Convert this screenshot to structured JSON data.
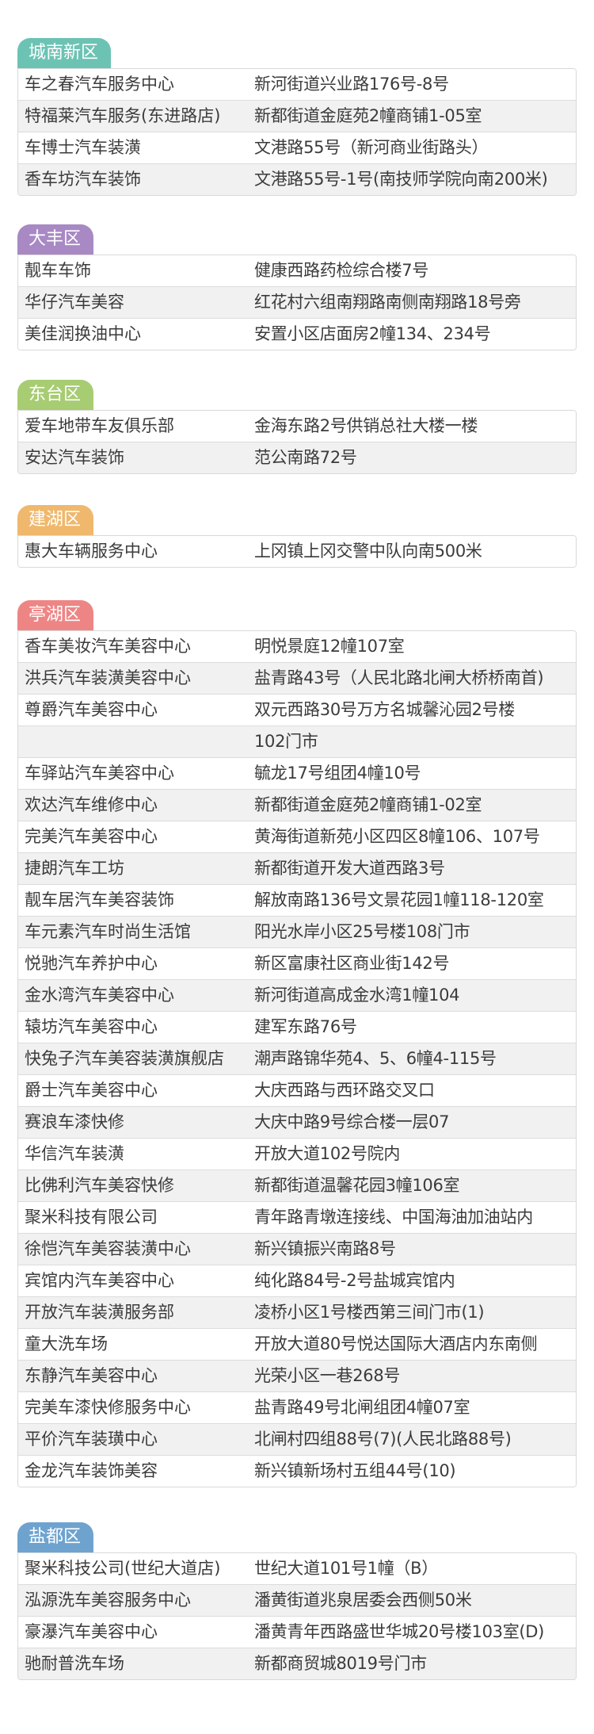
{
  "sections": [
    {
      "district": "城南新区",
      "color": "#6cc3b4",
      "rows": [
        [
          "车之春汽车服务中心",
          "新河街道兴业路176号-8号"
        ],
        [
          "特福莱汽车服务(东进路店)",
          "新都街道金庭苑2幢商铺1-05室"
        ],
        [
          "车博士汽车装潢",
          "文港路55号（新河商业街路头）"
        ],
        [
          "香车坊汽车装饰",
          "文港路55号-1号(南技师学院向南200米)"
        ]
      ]
    },
    {
      "district": "大丰区",
      "color": "#a889c4",
      "rows": [
        [
          "靓车车饰",
          "健康西路药检综合楼7号"
        ],
        [
          "华仔汽车美容",
          "红花村六组南翔路南侧南翔路18号旁"
        ],
        [
          "美佳润换油中心",
          "安置小区店面房2幢134、234号"
        ]
      ]
    },
    {
      "district": "东台区",
      "color": "#a7cc72",
      "rows": [
        [
          "爱车地带车友俱乐部",
          "金海东路2号供销总社大楼一楼"
        ],
        [
          "安达汽车装饰",
          "范公南路72号"
        ]
      ]
    },
    {
      "district": "建湖区",
      "color": "#efb86d",
      "rows": [
        [
          "惠大车辆服务中心",
          "上冈镇上冈交警中队向南500米"
        ]
      ]
    },
    {
      "district": "亭湖区",
      "color": "#ee8585",
      "rows": [
        [
          "香车美妆汽车美容中心",
          "明悦景庭12幢107室"
        ],
        [
          "洪兵汽车装潢美容中心",
          "盐青路43号（人民北路北闸大桥桥南首)"
        ],
        [
          "尊爵汽车美容中心",
          "双元西路30号万方名城馨沁园2号楼"
        ],
        [
          "",
          "102门市"
        ],
        [
          "车驿站汽车美容中心",
          "毓龙17号组团4幢10号"
        ],
        [
          "欢达汽车维修中心",
          "新都街道金庭苑2幢商铺1-02室"
        ],
        [
          "完美汽车美容中心",
          "黄海街道新苑小区四区8幢106、107号"
        ],
        [
          "捷朗汽车工坊",
          "新都街道开发大道西路3号"
        ],
        [
          "靓车居汽车美容装饰",
          "解放南路136号文景花园1幢118-120室"
        ],
        [
          "车元素汽车时尚生活馆",
          "阳光水岸小区25号楼108门市"
        ],
        [
          "悦驰汽车养护中心",
          "新区富康社区商业街142号"
        ],
        [
          "金水湾汽车美容中心",
          "新河街道高成金水湾1幢104"
        ],
        [
          "辕坊汽车美容中心",
          "建军东路76号"
        ],
        [
          "快兔子汽车美容装潢旗舰店",
          "潮声路锦华苑4、5、6幢4-115号"
        ],
        [
          "爵士汽车美容中心",
          "大庆西路与西环路交叉口"
        ],
        [
          "赛浪车漆快修",
          "大庆中路9号综合楼一层07"
        ],
        [
          "华信汽车装潢",
          "开放大道102号院内"
        ],
        [
          "比佛利汽车美容快修",
          "新都街道温馨花园3幢106室"
        ],
        [
          "聚米科技有限公司",
          "青年路青墩连接线、中国海油加油站内"
        ],
        [
          "徐恺汽车美容装潢中心",
          "新兴镇振兴南路8号"
        ],
        [
          "宾馆内汽车美容中心",
          "纯化路84号-2号盐城宾馆内"
        ],
        [
          "开放汽车装潢服务部",
          "凌桥小区1号楼西第三间门市(1)"
        ],
        [
          "童大洗车场",
          "开放大道80号悦达国际大酒店内东南侧"
        ],
        [
          "东静汽车美容中心",
          "光荣小区一巷268号"
        ],
        [
          "完美车漆快修服务中心",
          "盐青路49号北闸组团4幢07室"
        ],
        [
          "平价汽车装璜中心",
          "北闸村四组88号(7)(人民北路88号)"
        ],
        [
          "金龙汽车装饰美容",
          "新兴镇新场村五组44号(10)"
        ]
      ]
    },
    {
      "district": "盐都区",
      "color": "#6ea3cf",
      "rows": [
        [
          "聚米科技公司(世纪大道店)",
          "世纪大道101号1幢（B）"
        ],
        [
          "泓源洗车美容服务中心",
          "潘黄街道兆泉居委会西侧50米"
        ],
        [
          "豪瀑汽车美容中心",
          "潘黄青年西路盛世华城20号楼103室(D)"
        ],
        [
          "驰耐普洗车场",
          "新都商贸城8019号门市"
        ]
      ]
    }
  ]
}
